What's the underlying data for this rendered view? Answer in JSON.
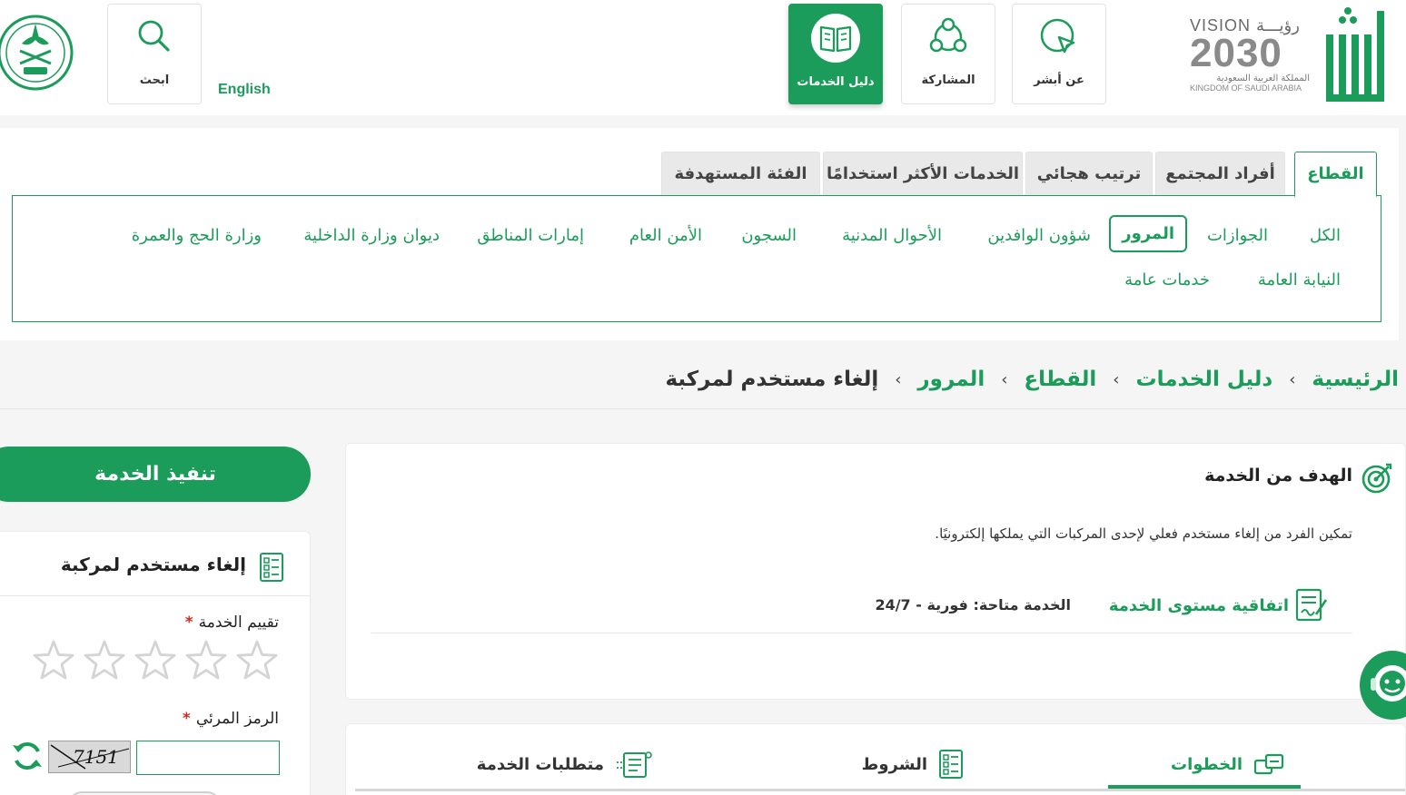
{
  "header": {
    "vision_text": "VISION",
    "vision_arabic": "رؤيـــة",
    "vision_year": "2030",
    "kingdom_ar": "المملكة العربية السعودية",
    "kingdom_en": "KINGDOM OF SAUDI ARABIA",
    "nav": [
      {
        "label": "عن أبشر",
        "icon": "cursor-icon"
      },
      {
        "label": "المشاركة",
        "icon": "share-nodes-icon"
      },
      {
        "label": "دليل الخدمات",
        "icon": "book-icon",
        "active": true
      }
    ],
    "english_label": "English",
    "search_label": "ابحث",
    "accent_color": "#1b9c5a"
  },
  "tabs": {
    "items": [
      "القطاع",
      "أفراد المجتمع",
      "ترتيب هجائي",
      "الخدمات الأكثر استخدامًا",
      "الفئة المستهدفة"
    ],
    "active": "القطاع"
  },
  "sectors": {
    "row1": [
      "الكل",
      "الجوازات",
      "المرور",
      "شؤون الوافدين",
      "الأحوال المدنية",
      "السجون",
      "الأمن العام",
      "إمارات المناطق",
      "ديوان وزارة الداخلية",
      "وزارة الحج والعمرة"
    ],
    "row2": [
      "النيابة العامة",
      "خدمات عامة"
    ],
    "active": "المرور"
  },
  "breadcrumb": {
    "items": [
      "الرئيسية",
      "دليل الخدمات",
      "القطاع",
      "المرور"
    ],
    "current": "إلغاء مستخدم لمركبة",
    "separator": "›"
  },
  "objective": {
    "title": "الهدف من الخدمة",
    "description": "تمكين الفرد من إلغاء مستخدم فعلي لإحدى المركبات التي يملكها إلكترونيًا.",
    "sla_link": "اتفاقية مستوى الخدمة",
    "availability": "الخدمة متاحة: فورية - 24/7"
  },
  "service_tabs": {
    "items": [
      "الخطوات",
      "الشروط",
      "متطلبات الخدمة"
    ],
    "active": "الخطوات"
  },
  "sidebar": {
    "execute_button": "تنفيذ الخدمة",
    "service_title": "إلغاء مستخدم لمركبة",
    "rating_label": "تقييم الخدمة",
    "rating_value": 0,
    "stars_total": 5,
    "captcha_label": "الرمز المرئي",
    "captcha_text": "7151",
    "captcha_input_value": "",
    "required_mark": "*"
  }
}
